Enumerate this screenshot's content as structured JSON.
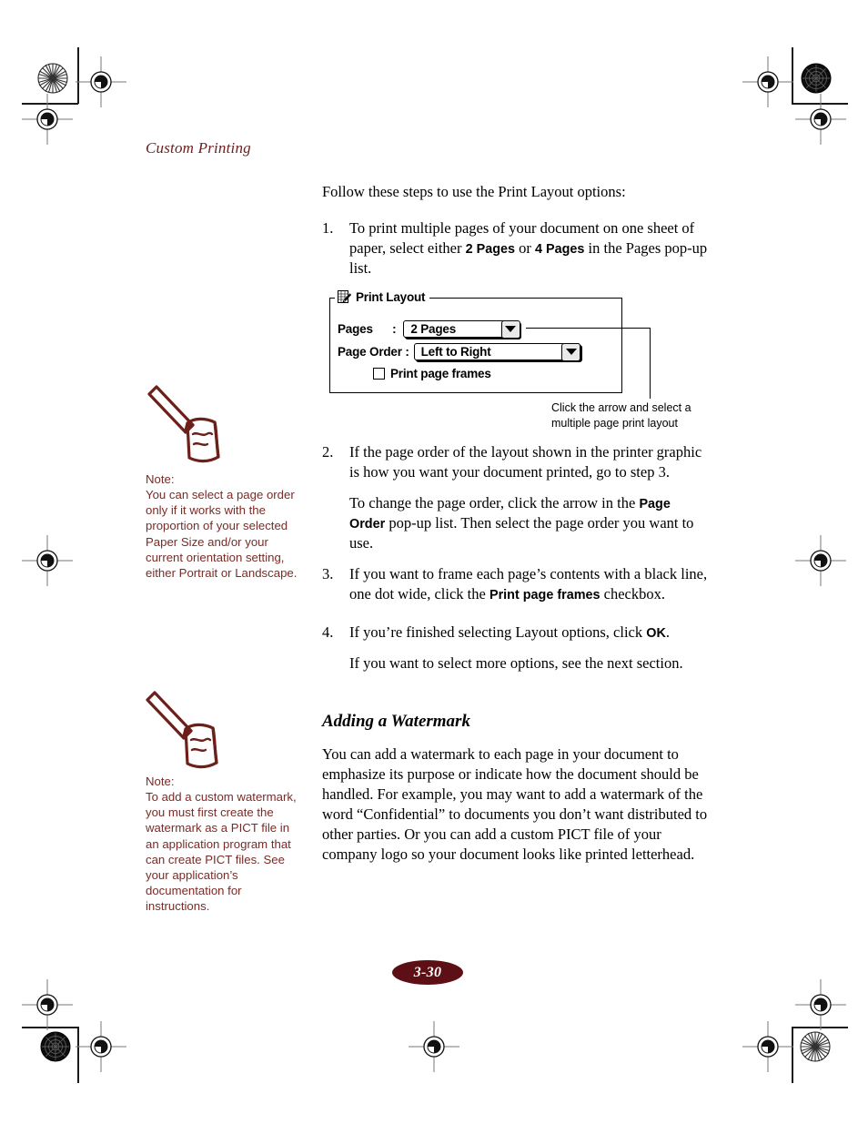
{
  "page": {
    "running_head": "Custom Printing",
    "folio": "3-30"
  },
  "main": {
    "lead": "Follow these steps to use the Print Layout options:",
    "steps": [
      {
        "num": "1.",
        "paras": [
          "To print multiple pages of your document on one sheet of paper, select either 2 Pages or 4 Pages in the Pages pop-up list."
        ]
      },
      {
        "num": "2.",
        "paras": [
          "If the page order of the layout shown in the printer graphic is how you want your document printed, go to step 3.",
          "To change the page order, click the arrow in the Page Order pop-up list. Then select the page order you want to use."
        ]
      },
      {
        "num": "3.",
        "paras": [
          "If you want to frame each page’s contents with a black line, one dot wide, click the Print page frames checkbox."
        ]
      },
      {
        "num": "4.",
        "paras": [
          "If you’re finished selecting Layout options, click OK.",
          "If you want to select more options, see the next section."
        ]
      }
    ],
    "section": {
      "heading": "Adding a Watermark",
      "paragraph": "You can add a watermark to each page in your document to emphasize its purpose or indicate how the document should be handled. For example, you may want to add a watermark of the word “Confidential” to documents you don’t want distributed to other parties. Or you can add a custom PICT file of your company logo so your document looks like printed letterhead."
    }
  },
  "figure": {
    "groupbox_title": "Print Layout",
    "icon_name": "print-layout-icon",
    "rows": [
      {
        "label": "Pages      :",
        "value": "2 Pages"
      },
      {
        "label": "Page Order :",
        "value": "Left to Right"
      }
    ],
    "checkbox_label": "Print page frames",
    "checkbox_checked": false,
    "callout": "Click the arrow and select a multiple page print layout"
  },
  "notes": [
    {
      "label": "Note:",
      "text": "You can select a page order only if it works with the proportion of your selected Paper Size and/or your current orientation setting, either Portrait or Landscape."
    },
    {
      "label": "Note:",
      "text": "To add a custom watermark, you must first create the watermark as a PICT file in an application program that can create PICT files. See your application’s documentation for instructions."
    }
  ],
  "colors": {
    "accent_maroon": "#7a2b26",
    "running_head": "#6b1f1f",
    "folio_bg": "#5c0f14",
    "ink": "#000000"
  }
}
